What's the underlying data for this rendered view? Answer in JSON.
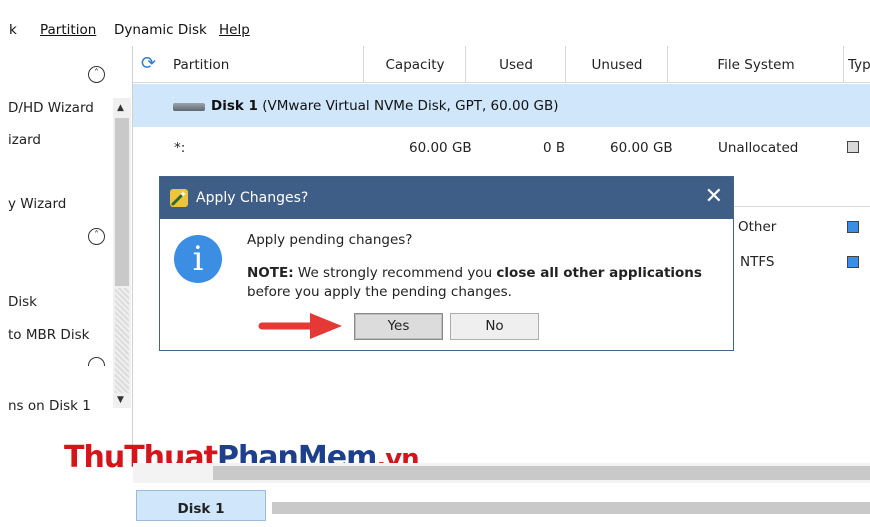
{
  "menu": {
    "item0": "k",
    "item1": "Partition",
    "item2": "Dynamic Disk",
    "item3": "Help"
  },
  "left_panel": {
    "items": [
      "D/HD Wizard",
      "izard",
      "y Wizard",
      "Disk",
      "to MBR Disk",
      "ns on Disk 1"
    ]
  },
  "table": {
    "columns": [
      "Partition",
      "Capacity",
      "Used",
      "Unused",
      "File System",
      "Type"
    ],
    "disk_row": {
      "name": "Disk 1",
      "desc": "(VMware Virtual NVMe Disk, GPT, 60.00 GB)"
    },
    "rows": [
      {
        "partition": "*:",
        "capacity": "60.00 GB",
        "used": "0 B",
        "unused": "60.00 GB",
        "fs": "Unallocated"
      },
      {
        "fs": "Other"
      },
      {
        "fs": "NTFS"
      }
    ]
  },
  "dialog": {
    "title": "Apply Changes?",
    "question": "Apply pending changes?",
    "note_bold": "NOTE:",
    "note_1": " We strongly recommend you ",
    "note_bold2": "close all other applications",
    "note_2": " before you apply the pending changes.",
    "yes": "Yes",
    "no": "No"
  },
  "watermark": {
    "part1": "Thu",
    "part2": "Thuat",
    "part3": "PhanMem",
    "part4": ".vn"
  },
  "bottom": {
    "disk": "Disk 1"
  },
  "colors": {
    "title_bar": "#3f5e87",
    "selection": "#cfe6fb",
    "info": "#3b8ee3",
    "arrow": "#e53935"
  }
}
